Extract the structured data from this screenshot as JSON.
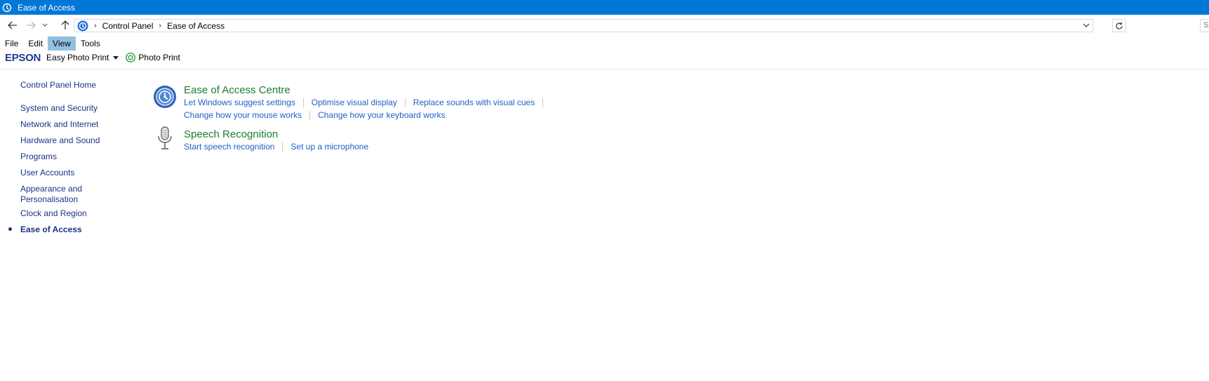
{
  "window": {
    "title": "Ease of Access"
  },
  "address": {
    "breadcrumbs": [
      "Control Panel",
      "Ease of Access"
    ],
    "search_placeholder": "Se"
  },
  "menubar": {
    "items": [
      "File",
      "Edit",
      "View",
      "Tools"
    ],
    "active": "View"
  },
  "epson": {
    "logo": "EPSON",
    "app": "Easy Photo Print",
    "photo": "Photo Print"
  },
  "sidebar": {
    "home": "Control Panel Home",
    "items": [
      "System and Security",
      "Network and Internet",
      "Hardware and Sound",
      "Programs",
      "User Accounts",
      "Appearance and",
      "Personalisation",
      "Clock and Region",
      "Ease of Access"
    ]
  },
  "sections": [
    {
      "title": "Ease of Access Centre",
      "icon": "ease-of-access-icon",
      "rows": [
        [
          "Let Windows suggest settings",
          "Optimise visual display",
          "Replace sounds with visual cues"
        ],
        [
          "Change how your mouse works",
          "Change how your keyboard works"
        ]
      ]
    },
    {
      "title": "Speech Recognition",
      "icon": "microphone-icon",
      "rows": [
        [
          "Start speech recognition",
          "Set up a microphone"
        ]
      ]
    }
  ],
  "colors": {
    "titlebar": "#0078d7",
    "section_title": "#1e7d2f",
    "link": "#1f5fc4",
    "nav_link": "#1e3287"
  }
}
